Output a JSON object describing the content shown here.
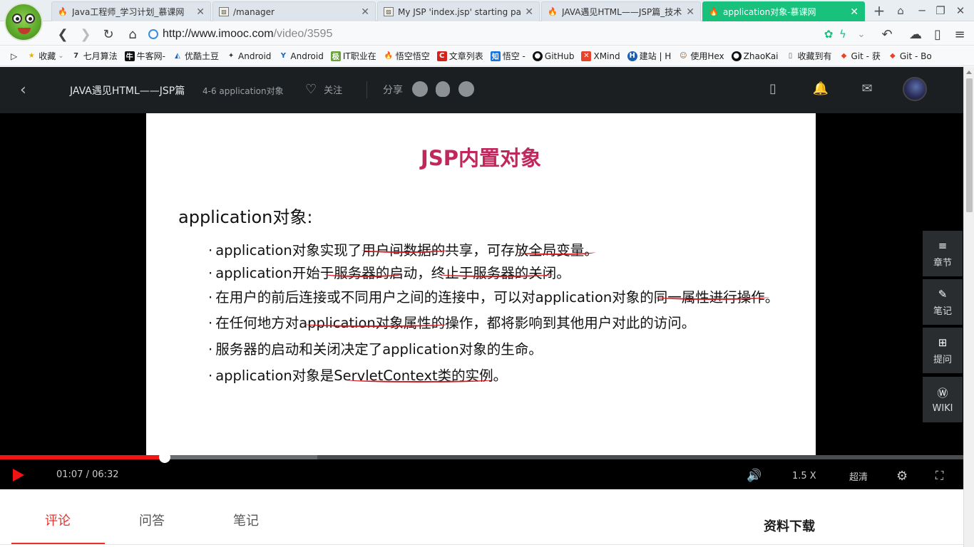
{
  "browser": {
    "tabs": [
      {
        "title": "Java工程师_学习计划_慕课网",
        "favicon": "fire-icon",
        "active": false
      },
      {
        "title": "/manager",
        "favicon": "image-icon",
        "active": false
      },
      {
        "title": "My JSP 'index.jsp' starting pag",
        "favicon": "image-icon",
        "active": false
      },
      {
        "title": "JAVA遇见HTML——JSP篇_技术",
        "favicon": "fire-icon",
        "active": false
      },
      {
        "title": "application对象-慕课网",
        "favicon": "fire-icon",
        "active": true
      }
    ],
    "new_tab": "+",
    "url_host": "http://www.imooc.com",
    "url_path": "/video/3595",
    "accent": "#18c27d",
    "bookmarks": [
      {
        "label": "收藏",
        "icon": "star-icon"
      },
      {
        "label": "七月算法",
        "icon": "seven-icon"
      },
      {
        "label": "牛客网-",
        "icon": "niuke-icon"
      },
      {
        "label": "优酷土豆",
        "icon": "youku-icon"
      },
      {
        "label": "Android",
        "icon": "android-icon"
      },
      {
        "label": "Android",
        "icon": "android-y-icon"
      },
      {
        "label": "IT职业在",
        "icon": "it-icon"
      },
      {
        "label": "悟空悟空",
        "icon": "fire-icon"
      },
      {
        "label": "文章列表",
        "icon": "csdn-icon"
      },
      {
        "label": "悟空 -",
        "icon": "zhihu-icon"
      },
      {
        "label": "GitHub",
        "icon": "github-icon"
      },
      {
        "label": "XMind",
        "icon": "xmind-icon"
      },
      {
        "label": "建站 | H",
        "icon": "h-icon"
      },
      {
        "label": "使用Hex",
        "icon": "hexo-icon"
      },
      {
        "label": "ZhaoKai",
        "icon": "github-icon"
      },
      {
        "label": "收藏到有",
        "icon": "doc-icon"
      },
      {
        "label": "Git - 获",
        "icon": "git-icon"
      },
      {
        "label": "Git - Bo",
        "icon": "git-icon"
      }
    ]
  },
  "header": {
    "course_title": "JAVA遇见HTML——JSP篇",
    "lesson": "4-6 application对象",
    "follow_label": "关注",
    "share_label": "分享"
  },
  "slide": {
    "title": "JSP内置对象",
    "heading": "application对象:",
    "title_color": "#c0275c",
    "underline_color": "#d2171f",
    "bullets": [
      "application对象实现了用户间数据的共享，可存放全局变量。",
      "application开始于服务器的启动，终止于服务器的关闭。",
      "在用户的前后连接或不同用户之间的连接中，可以对application对象的同一属性进行操作。",
      "在任何地方对application对象属性的操作，都将影响到其他用户对此的访问。",
      "服务器的启动和关闭决定了application对象的生命。",
      "application对象是ServletContext类的实例。"
    ]
  },
  "side_panel": {
    "chapter": "章节",
    "notes": "笔记",
    "ask": "提问",
    "wiki": "WIKI"
  },
  "player": {
    "current_time": "01:07",
    "duration": "06:32",
    "time_display": "01:07 / 06:32",
    "progress": 0.171,
    "speed": "1.5 X",
    "quality": "超清",
    "progress_color": "#f01414"
  },
  "page": {
    "tabs": [
      "评论",
      "问答",
      "笔记"
    ],
    "active_tab": 0,
    "downloads_title": "资料下载"
  }
}
